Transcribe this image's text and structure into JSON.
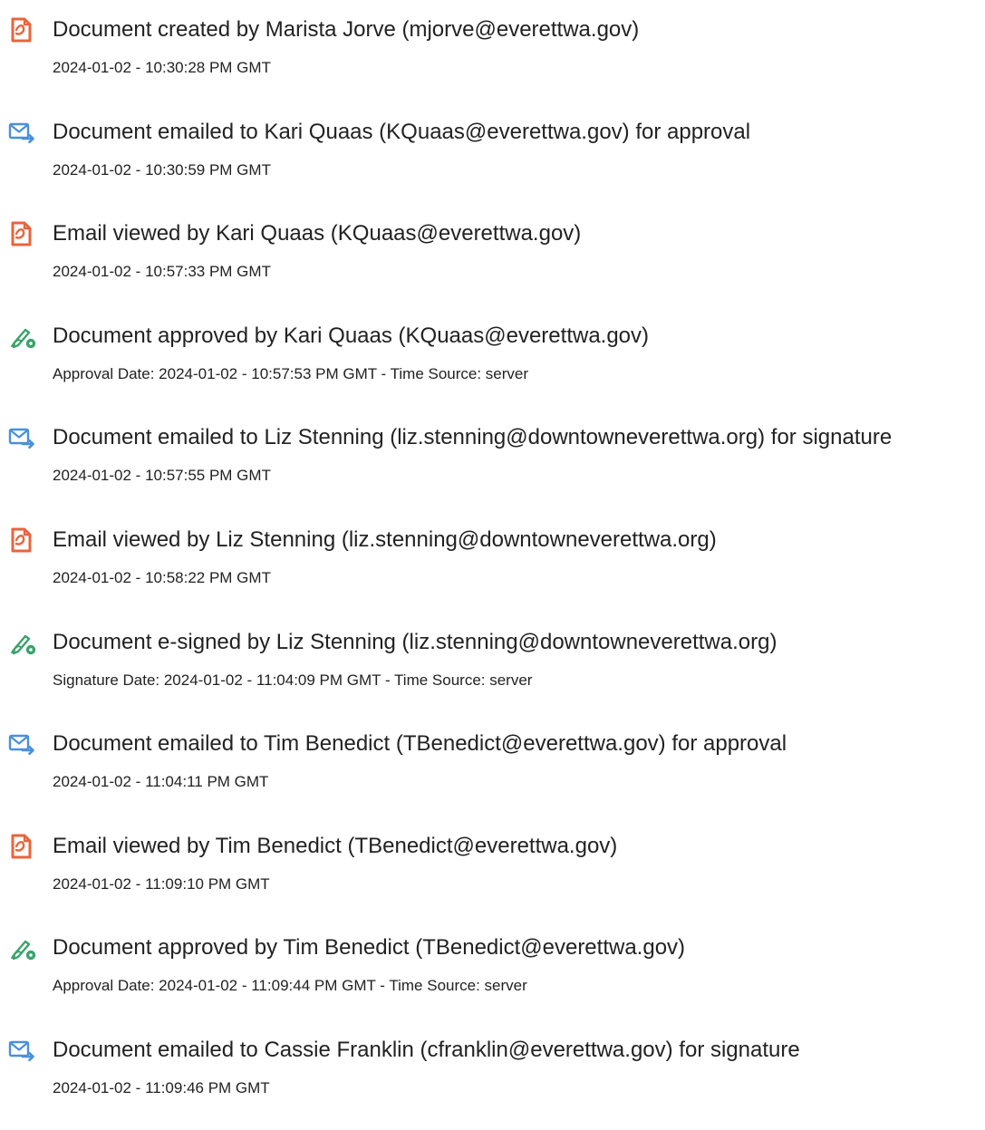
{
  "colors": {
    "created_icon": "#e8643c",
    "email_icon": "#4a90d9",
    "sign_icon": "#3aa36b",
    "text": "#222222"
  },
  "entries": [
    {
      "icon": "document-icon",
      "text": "Document created by Marista Jorve (mjorve@everettwa.gov)",
      "timestamp": "2024-01-02 - 10:30:28 PM GMT"
    },
    {
      "icon": "email-send-icon",
      "text": "Document emailed to Kari Quaas (KQuaas@everettwa.gov) for approval",
      "timestamp": "2024-01-02 - 10:30:59 PM GMT"
    },
    {
      "icon": "document-icon",
      "text": "Email viewed by Kari Quaas (KQuaas@everettwa.gov)",
      "timestamp": "2024-01-02 - 10:57:33 PM GMT"
    },
    {
      "icon": "pen-sign-icon",
      "text": "Document approved by Kari Quaas (KQuaas@everettwa.gov)",
      "timestamp": "Approval Date: 2024-01-02 - 10:57:53 PM GMT - Time Source: server"
    },
    {
      "icon": "email-send-icon",
      "text": "Document emailed to Liz Stenning (liz.stenning@downtowneverettwa.org) for signature",
      "timestamp": "2024-01-02 - 10:57:55 PM GMT"
    },
    {
      "icon": "document-icon",
      "text": "Email viewed by Liz Stenning (liz.stenning@downtowneverettwa.org)",
      "timestamp": "2024-01-02 - 10:58:22 PM GMT"
    },
    {
      "icon": "pen-sign-icon",
      "text": "Document e-signed by Liz Stenning (liz.stenning@downtowneverettwa.org)",
      "timestamp": "Signature Date: 2024-01-02 - 11:04:09 PM GMT - Time Source: server"
    },
    {
      "icon": "email-send-icon",
      "text": "Document emailed to Tim Benedict (TBenedict@everettwa.gov) for approval",
      "timestamp": "2024-01-02 - 11:04:11 PM GMT"
    },
    {
      "icon": "document-icon",
      "text": "Email viewed by Tim Benedict (TBenedict@everettwa.gov)",
      "timestamp": "2024-01-02 - 11:09:10 PM GMT"
    },
    {
      "icon": "pen-sign-icon",
      "text": "Document approved by Tim Benedict (TBenedict@everettwa.gov)",
      "timestamp": "Approval Date: 2024-01-02 - 11:09:44 PM GMT - Time Source: server"
    },
    {
      "icon": "email-send-icon",
      "text": "Document emailed to Cassie Franklin (cfranklin@everettwa.gov) for signature",
      "timestamp": "2024-01-02 - 11:09:46 PM GMT"
    }
  ]
}
